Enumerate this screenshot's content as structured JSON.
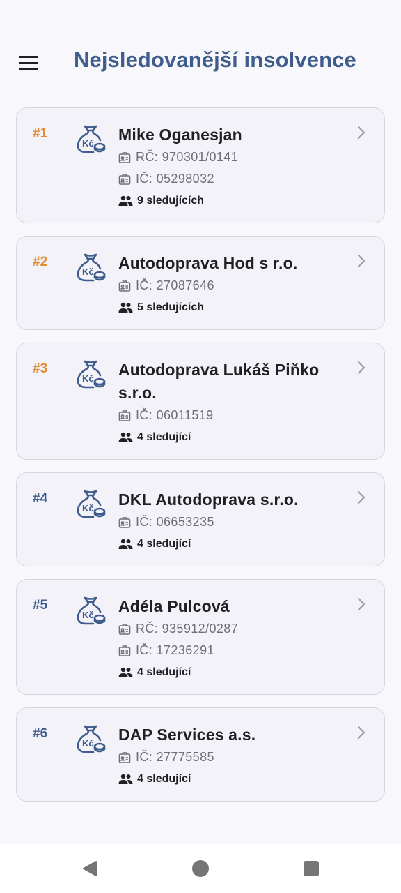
{
  "header": {
    "title": "Nejsledovanější insolvence",
    "menu_icon": "hamburger-menu-icon"
  },
  "colors": {
    "title": "#3f5d8c",
    "rank_top3": "#e28b2f",
    "rank_other": "#3f5d8c",
    "icon": "#3f5d8c"
  },
  "items": [
    {
      "rank": "#1",
      "rank_style": "top",
      "name": "Mike Oganesjan",
      "rc": "RČ: 970301/0141",
      "ic": "IČ: 05298032",
      "followers": "9 sledujících"
    },
    {
      "rank": "#2",
      "rank_style": "top",
      "name": "Autodoprava Hod s r.o.",
      "ic": "IČ: 27087646",
      "followers": "5 sledujících"
    },
    {
      "rank": "#3",
      "rank_style": "top",
      "name": "Autodoprava Lukáš Piňko s.r.o.",
      "ic": "IČ: 06011519",
      "followers": "4 sledující"
    },
    {
      "rank": "#4",
      "rank_style": "other",
      "name": "DKL Autodoprava s.r.o.",
      "ic": "IČ: 06653235",
      "followers": "4 sledující"
    },
    {
      "rank": "#5",
      "rank_style": "other",
      "name": "Adéla Pulcová",
      "rc": "RČ: 935912/0287",
      "ic": "IČ: 17236291",
      "followers": "4 sledující"
    },
    {
      "rank": "#6",
      "rank_style": "other",
      "name": "DAP Services a.s.",
      "ic": "IČ: 27775585",
      "followers": "4 sledující"
    }
  ],
  "icons": {
    "card_icon": "money-bag-kc-icon",
    "id_icon": "id-card-icon",
    "followers_icon": "people-icon",
    "chevron": "chevron-right-icon"
  },
  "navbar": {
    "back_icon": "back-triangle-icon",
    "home_icon": "home-circle-icon",
    "recents_icon": "recents-square-icon"
  }
}
